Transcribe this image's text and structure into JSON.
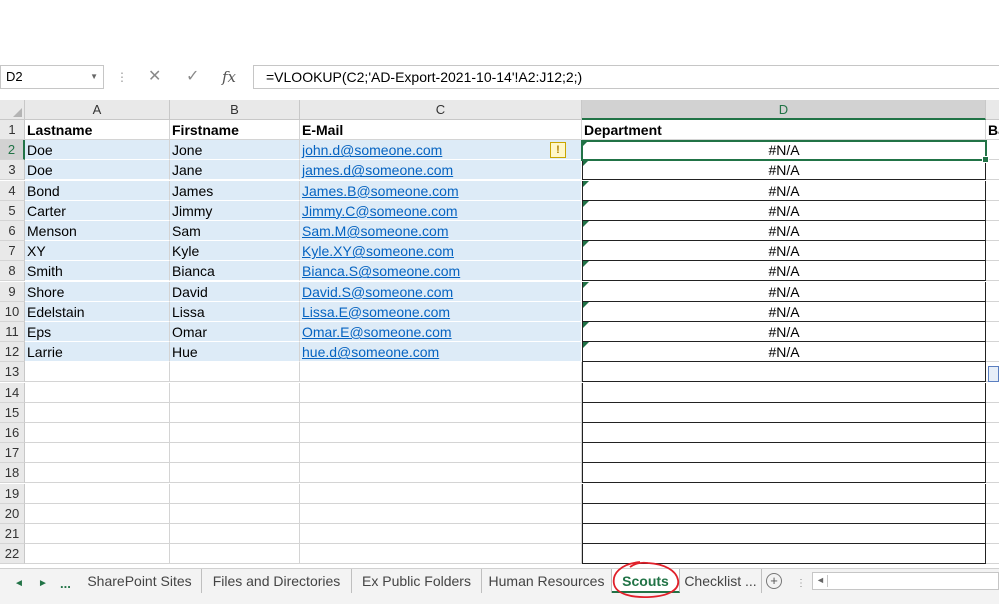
{
  "formula_bar": {
    "name_box": "D2",
    "cancel_icon": "close-icon",
    "enter_icon": "checkmark-icon",
    "fx_label": "fx",
    "formula": "=VLOOKUP(C2;'AD-Export-2021-10-14'!A2:J12;2;)"
  },
  "columns": [
    {
      "label": "A"
    },
    {
      "label": "B"
    },
    {
      "label": "C"
    },
    {
      "label": "D",
      "selected": true
    }
  ],
  "headers": {
    "a": "Lastname",
    "b": "Firstname",
    "c": "E-Mail",
    "d": "Department",
    "e": "Ba"
  },
  "row_numbers": [
    "1",
    "2",
    "3",
    "4",
    "5",
    "6",
    "7",
    "8",
    "9",
    "10",
    "11",
    "12",
    "13",
    "14",
    "15",
    "16",
    "17",
    "18",
    "19",
    "20",
    "21",
    "22"
  ],
  "rows": [
    {
      "lastname": "Doe",
      "firstname": "Jone",
      "email": "john.d@someone.com",
      "department": "#N/A"
    },
    {
      "lastname": "Doe",
      "firstname": "Jane",
      "email": "james.d@someone.com",
      "department": "#N/A"
    },
    {
      "lastname": "Bond",
      "firstname": "James",
      "email": "James.B@someone.com",
      "department": "#N/A"
    },
    {
      "lastname": "Carter",
      "firstname": "Jimmy",
      "email": "Jimmy.C@someone.com",
      "department": "#N/A"
    },
    {
      "lastname": "Menson",
      "firstname": "Sam",
      "email": "Sam.M@someone.com",
      "department": "#N/A"
    },
    {
      "lastname": "XY",
      "firstname": "Kyle",
      "email": "Kyle.XY@someone.com",
      "department": "#N/A"
    },
    {
      "lastname": "Smith",
      "firstname": "Bianca",
      "email": "Bianca.S@someone.com",
      "department": "#N/A"
    },
    {
      "lastname": "Shore",
      "firstname": "David",
      "email": "David.S@someone.com",
      "department": "#N/A"
    },
    {
      "lastname": "Edelstain",
      "firstname": "Lissa",
      "email": "Lissa.E@someone.com",
      "department": "#N/A"
    },
    {
      "lastname": "Eps",
      "firstname": "Omar",
      "email": "Omar.E@someone.com",
      "department": "#N/A"
    },
    {
      "lastname": "Larrie",
      "firstname": "Hue",
      "email": "hue.d@someone.com",
      "department": "#N/A"
    }
  ],
  "sheet_tabs": {
    "more_left": "...",
    "tabs": [
      {
        "label": "SharePoint Sites"
      },
      {
        "label": "Files and Directories"
      },
      {
        "label": "Ex Public Folders"
      },
      {
        "label": "Human Resources"
      },
      {
        "label": "Scouts",
        "active": true
      },
      {
        "label": "Checklist ..."
      }
    ],
    "add_sheet_icon": "plus-circle-icon"
  },
  "colors": {
    "accent": "#217346",
    "band": "#ddebf7",
    "link": "#0563c1",
    "annotation": "#e0202a"
  }
}
